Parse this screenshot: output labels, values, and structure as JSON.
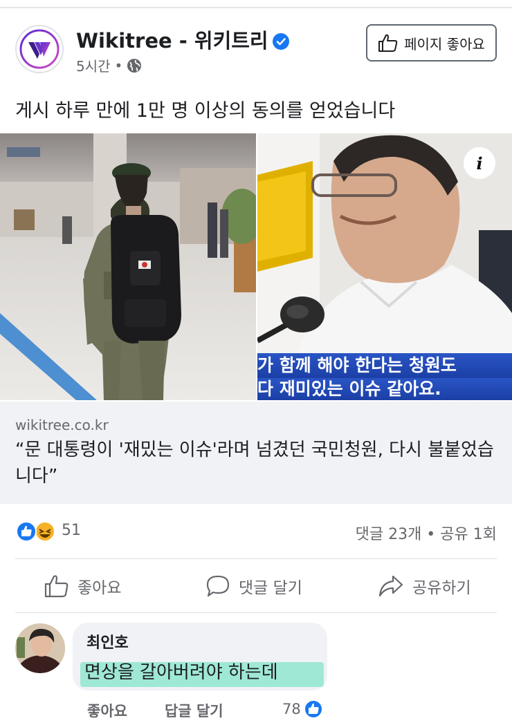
{
  "post": {
    "page_name": "Wikitree - 위키트리",
    "time": "5시간",
    "separator": "•",
    "like_page_label": "페이지 좋아요",
    "caption": "게시 하루 만에 1만 명 이상의 동의를 얻었습니다"
  },
  "image_right": {
    "subtitle_line1": "가 함께 해야 한다는 청원도",
    "subtitle_line2": "다 재미있는 이슈 같아요."
  },
  "link": {
    "domain": "wikitree.co.kr",
    "title": "“문 대통령이 '재밌는 이슈'라며 넘겼던 국민청원, 다시 불붙었습니다”"
  },
  "reactions": {
    "count": "51",
    "stats": "댓글 23개 • 공유 1회"
  },
  "actions": {
    "like": "좋아요",
    "comment": "댓글 달기",
    "share": "공유하기"
  },
  "comment": {
    "author": "최인호",
    "text": "면상을 갈아버려야 하는데",
    "like_label": "좋아요",
    "reply_label": "답글 달기",
    "like_count": "78"
  },
  "colors": {
    "brand_blue": "#1877f2",
    "highlight": "#9fe8d6",
    "logo_purple": "#7a3cd8"
  },
  "icons": [
    "verified-badge-icon",
    "globe-icon",
    "thumbs-up-icon",
    "comment-icon",
    "share-icon",
    "info-icon",
    "like-reaction-icon",
    "haha-reaction-icon"
  ]
}
